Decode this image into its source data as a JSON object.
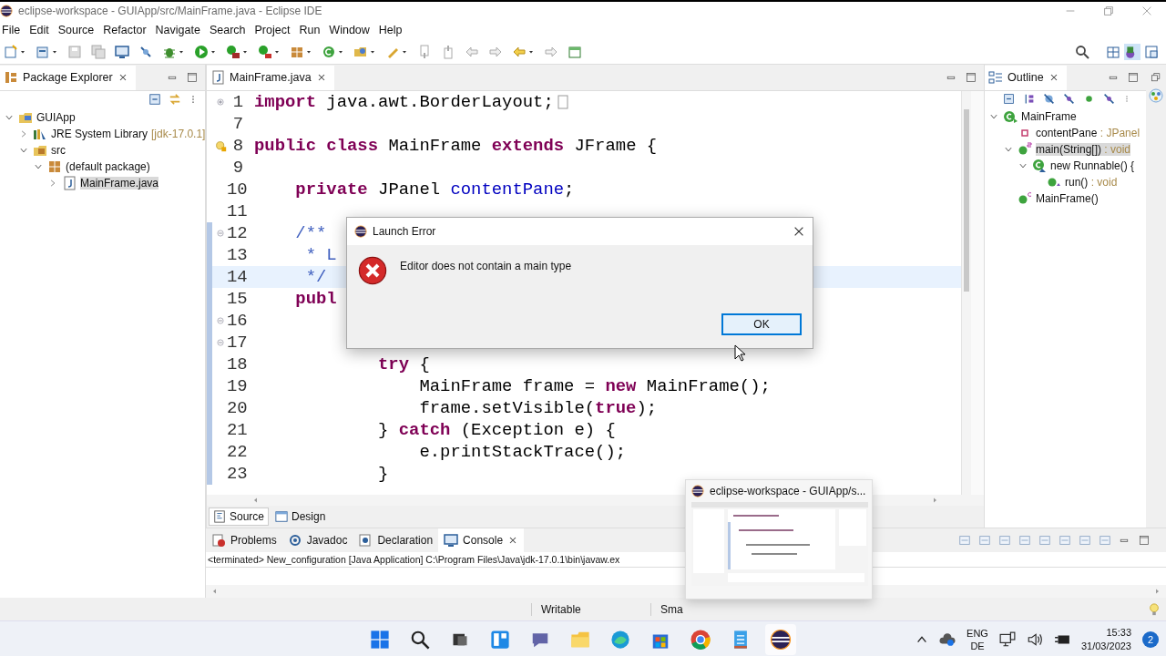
{
  "window": {
    "title": "eclipse-workspace - GUIApp/src/MainFrame.java - Eclipse IDE"
  },
  "menu": [
    "File",
    "Edit",
    "Source",
    "Refactor",
    "Navigate",
    "Search",
    "Project",
    "Run",
    "Window",
    "Help"
  ],
  "package_explorer": {
    "title": "Package Explorer",
    "tree": [
      {
        "label": "GUIApp",
        "kind": "project",
        "expanded": true,
        "selected": false,
        "children": [
          {
            "label": "JRE System Library",
            "decoration": "[jdk-17.0.1]",
            "kind": "library",
            "expanded": false,
            "selected": false
          },
          {
            "label": "src",
            "kind": "folder",
            "expanded": true,
            "selected": false,
            "children": [
              {
                "label": "(default package)",
                "kind": "package",
                "expanded": true,
                "selected": false,
                "children": [
                  {
                    "label": "MainFrame.java",
                    "kind": "file",
                    "expanded": false,
                    "selected": true
                  }
                ]
              }
            ]
          }
        ]
      }
    ]
  },
  "editor": {
    "tab": "MainFrame.java",
    "lines": [
      {
        "number": "1",
        "folded": true,
        "current": false,
        "in_range": false,
        "segments": [
          {
            "text": "import",
            "kind": "keyword"
          },
          {
            "text": " java.awt.BorderLayout;",
            "kind": "plain"
          }
        ]
      },
      {
        "number": "7",
        "current": false,
        "in_range": false
      },
      {
        "number": "8",
        "warning": true,
        "current": false,
        "in_range": false,
        "segments": [
          {
            "text": "public class",
            "kind": "keyword"
          },
          {
            "text": " MainFrame ",
            "kind": "plain"
          },
          {
            "text": "extends",
            "kind": "keyword"
          },
          {
            "text": " JFrame {",
            "kind": "plain"
          }
        ]
      },
      {
        "number": "9",
        "current": false,
        "in_range": false
      },
      {
        "number": "10",
        "current": false,
        "in_range": false,
        "segments": [
          {
            "text": "    private",
            "kind": "keyword"
          },
          {
            "text": " JPanel ",
            "kind": "plain"
          },
          {
            "text": "contentPane",
            "kind": "field"
          },
          {
            "text": ";",
            "kind": "plain"
          }
        ]
      },
      {
        "number": "11",
        "current": false,
        "in_range": false
      },
      {
        "number": "12",
        "folded": false,
        "current": false,
        "in_range": true,
        "segments": [
          {
            "text": "    /**",
            "kind": "comment"
          }
        ]
      },
      {
        "number": "13",
        "current": false,
        "in_range": true,
        "segments": [
          {
            "text": "     * L",
            "kind": "comment"
          }
        ]
      },
      {
        "number": "14",
        "current": true,
        "in_range": true,
        "segments": [
          {
            "text": "     */",
            "kind": "comment"
          }
        ]
      },
      {
        "number": "15",
        "current": false,
        "in_range": true,
        "segments": [
          {
            "text": "    publ",
            "kind": "keyword"
          }
        ]
      },
      {
        "number": "16",
        "folded": false,
        "current": false,
        "in_range": true
      },
      {
        "number": "17",
        "folded": false,
        "current": false,
        "in_range": true
      },
      {
        "number": "18",
        "current": false,
        "in_range": true,
        "segments": [
          {
            "text": "            try",
            "kind": "keyword"
          },
          {
            "text": " {",
            "kind": "plain"
          }
        ]
      },
      {
        "number": "19",
        "current": false,
        "in_range": true,
        "segments": [
          {
            "text": "                MainFrame frame = ",
            "kind": "plain"
          },
          {
            "text": "new",
            "kind": "keyword"
          },
          {
            "text": " MainFrame();",
            "kind": "plain"
          }
        ]
      },
      {
        "number": "20",
        "current": false,
        "in_range": true,
        "segments": [
          {
            "text": "                frame.setVisible(",
            "kind": "plain"
          },
          {
            "text": "true",
            "kind": "keyword"
          },
          {
            "text": ");",
            "kind": "plain"
          }
        ]
      },
      {
        "number": "21",
        "current": false,
        "in_range": true,
        "segments": [
          {
            "text": "            } ",
            "kind": "plain"
          },
          {
            "text": "catch",
            "kind": "keyword"
          },
          {
            "text": " (Exception e) {",
            "kind": "plain"
          }
        ]
      },
      {
        "number": "22",
        "current": false,
        "in_range": true,
        "segments": [
          {
            "text": "                e.printStackTrace();",
            "kind": "plain"
          }
        ]
      },
      {
        "number": "23",
        "current": false,
        "in_range": true,
        "segments": [
          {
            "text": "            }",
            "kind": "plain"
          }
        ]
      }
    ],
    "bottom_tabs": [
      {
        "label": "Source",
        "kind": "source",
        "selected": true
      },
      {
        "label": "Design",
        "kind": "design",
        "selected": false
      }
    ]
  },
  "outline": {
    "title": "Outline",
    "tree": [
      {
        "label": "MainFrame",
        "kind": "class",
        "expanded": true,
        "selected": false,
        "children": [
          {
            "label": "contentPane",
            "type": " : JPanel",
            "kind": "field",
            "selected": false
          },
          {
            "label": "main(String[])",
            "type": " : void",
            "kind": "static_method",
            "expanded": true,
            "selected": true,
            "children": [
              {
                "label": "new Runnable() {",
                "kind": "anonymous",
                "expanded": true,
                "selected": false,
                "children": [
                  {
                    "label": "run()",
                    "type": " : void",
                    "kind": "method",
                    "selected": false
                  }
                ]
              }
            ]
          },
          {
            "label": "MainFrame()",
            "kind": "constructor",
            "selected": false
          }
        ]
      }
    ]
  },
  "console": {
    "tabs": [
      {
        "label": "Problems",
        "kind": "problems",
        "selected": false
      },
      {
        "label": "Javadoc",
        "kind": "javadoc",
        "selected": false
      },
      {
        "label": "Declaration",
        "kind": "declaration",
        "selected": false
      },
      {
        "label": "Console",
        "kind": "console",
        "selected": true
      }
    ],
    "output": "<terminated> New_configuration [Java Application] C:\\Program Files\\Java\\jdk-17.0.1\\bin\\javaw.ex"
  },
  "status_bar": [
    "Writable",
    "Sma"
  ],
  "dialog": {
    "title": "Launch Error",
    "message": "Editor does not contain a main type",
    "button": "OK"
  },
  "taskbar_preview": {
    "title": "eclipse-workspace - GUIApp/s..."
  },
  "taskbar": {
    "language": "ENG",
    "layout": "DE",
    "time": "15:33",
    "date": "31/03/2023",
    "notifications": "2"
  }
}
